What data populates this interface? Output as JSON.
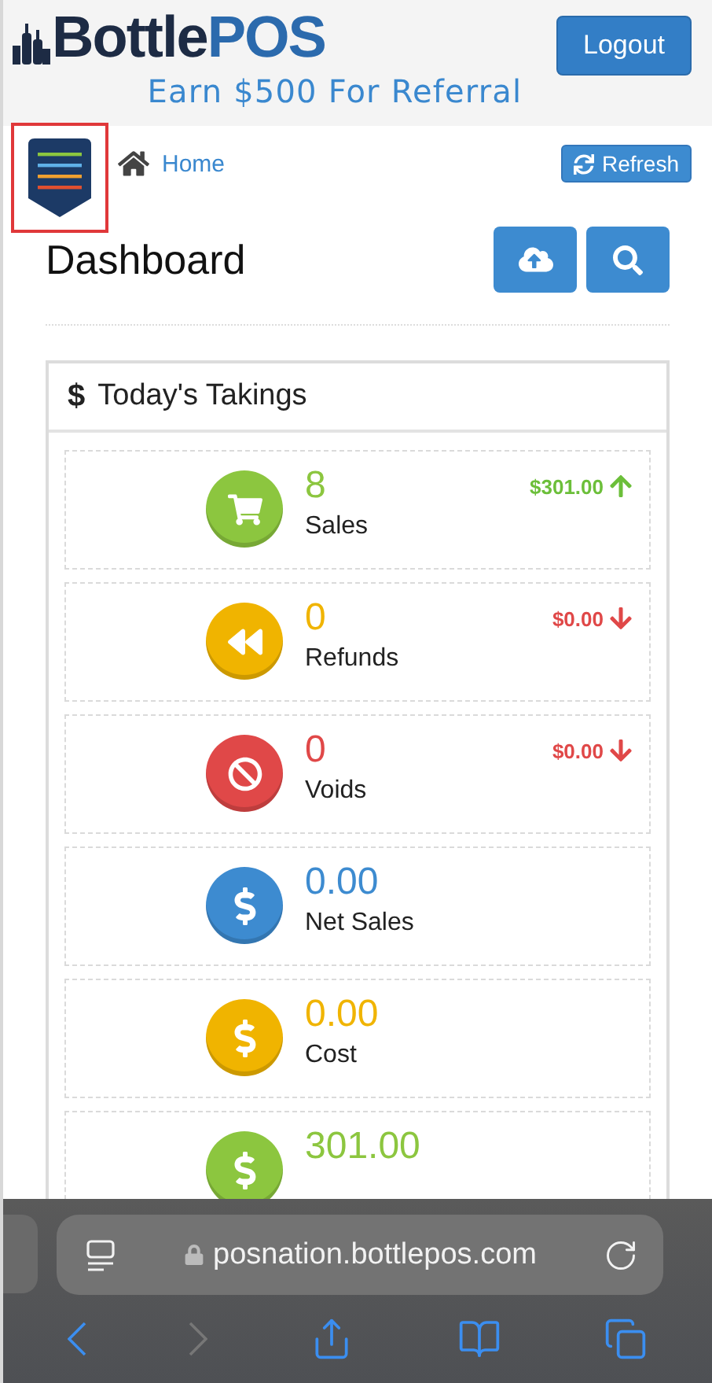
{
  "header": {
    "logo": {
      "first": "Bottle",
      "second": "POS"
    },
    "logout": "Logout",
    "promo": "Earn $500 For Referral"
  },
  "toolbar": {
    "menu_highlighted": true,
    "breadcrumb": "Home",
    "refresh": "Refresh"
  },
  "page": {
    "title": "Dashboard"
  },
  "panel": {
    "icon": "$",
    "title": "Today's Takings",
    "stats": [
      {
        "kind": "cart",
        "color": "#8cc63f",
        "value": "8",
        "label": "Sales",
        "trend": {
          "rising": true,
          "amount": "$301.00"
        }
      },
      {
        "kind": "rewind",
        "color": "#f0b400",
        "value": "0",
        "label": "Refunds",
        "trend": {
          "rising": false,
          "amount": "$0.00"
        }
      },
      {
        "kind": "ban",
        "color": "#e04848",
        "value": "0",
        "label": "Voids",
        "trend": {
          "rising": false,
          "amount": "$0.00"
        }
      },
      {
        "kind": "dollar",
        "color": "#3d8bd0",
        "value": "0.00",
        "label": "Net Sales"
      },
      {
        "kind": "dollar",
        "color": "#f0b400",
        "value": "0.00",
        "label": "Cost"
      },
      {
        "kind": "dollar",
        "color": "#8cc63f",
        "value": "301.00"
      }
    ]
  },
  "browser": {
    "url": "posnation.bottlepos.com",
    "buttons": [
      {
        "kind": "back",
        "disabled": false
      },
      {
        "kind": "forward",
        "disabled": true
      },
      {
        "kind": "share",
        "disabled": false
      },
      {
        "kind": "bookmarks",
        "disabled": false
      },
      {
        "kind": "tabs",
        "disabled": false
      }
    ]
  }
}
